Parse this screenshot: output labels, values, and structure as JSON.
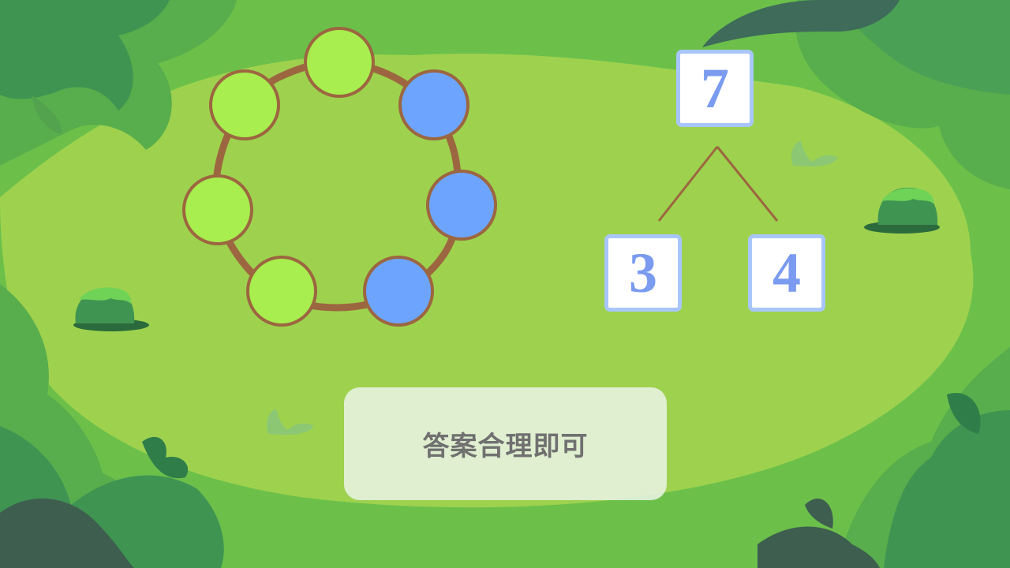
{
  "colors": {
    "sky_green": "#6cc04a",
    "meadow": "#9ed24e",
    "circle_green": "#a8ee4e",
    "circle_blue": "#6da5fe",
    "ring_brown": "#9c6640",
    "box_border": "#a8c6fb",
    "number_text": "#7a9bef",
    "answer_text": "#707070"
  },
  "bead_ring": {
    "beads": [
      {
        "color": "green"
      },
      {
        "color": "blue"
      },
      {
        "color": "blue"
      },
      {
        "color": "blue"
      },
      {
        "color": "green"
      },
      {
        "color": "green"
      },
      {
        "color": "green"
      }
    ]
  },
  "number_bond": {
    "whole": "7",
    "part_left": "3",
    "part_right": "4"
  },
  "answer_panel": {
    "text": "答案合理即可"
  }
}
